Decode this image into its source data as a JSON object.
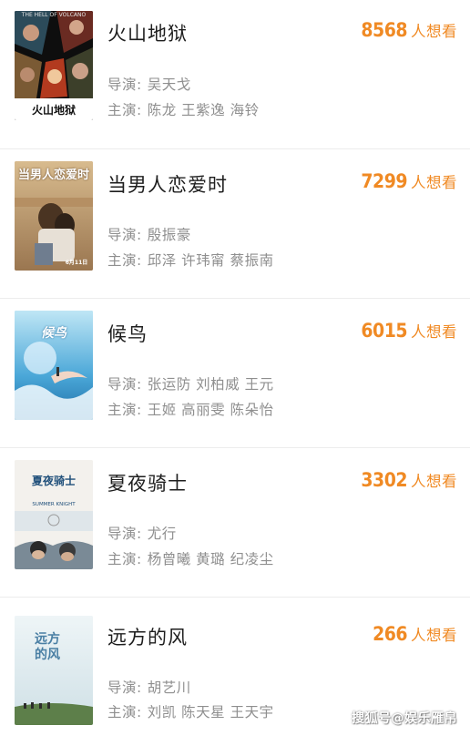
{
  "want_unit": "人想看",
  "labels": {
    "director": "导演:",
    "cast": "主演:"
  },
  "movies": [
    {
      "title": "火山地狱",
      "poster_title": "火山地狱",
      "poster_subtitle": "THE HELL OF VOLCANO",
      "want_count": "8568",
      "director": "吴天戈",
      "cast": "陈龙 王紫逸 海铃"
    },
    {
      "title": "当男人恋爱时",
      "poster_title": "当男人恋爱时",
      "poster_date": "6月11日",
      "want_count": "7299",
      "director": "殷振豪",
      "cast": "邱泽 许玮甯 蔡振南"
    },
    {
      "title": "候鸟",
      "poster_title": "候鸟",
      "want_count": "6015",
      "director": "张运防 刘柏威 王元",
      "cast": "王姬 高丽雯 陈朵怡"
    },
    {
      "title": "夏夜骑士",
      "poster_title": "夏夜骑士",
      "poster_subtitle": "SUMMER KNIGHT",
      "want_count": "3302",
      "director": "尤行",
      "cast": "杨曾曦 黄璐 纪凌尘"
    },
    {
      "title": "远方的风",
      "poster_title": "远方的风",
      "want_count": "266",
      "director": "胡艺川",
      "cast": "刘凯 陈天星 王天宇"
    }
  ],
  "watermark": "搜狐号@娱乐雁帛"
}
